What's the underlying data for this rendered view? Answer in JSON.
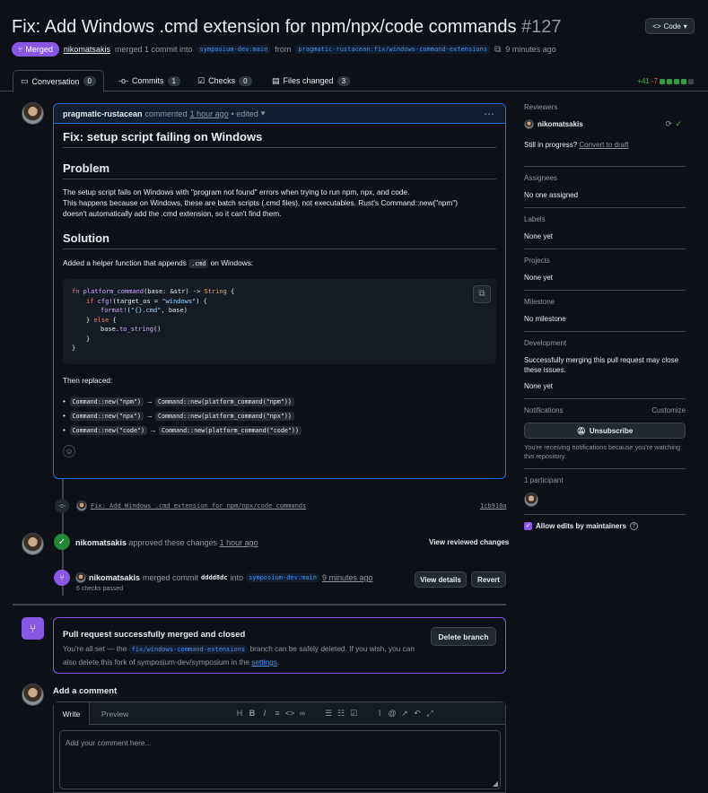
{
  "pr": {
    "title": "Fix: Add Windows .cmd extension for npm/npx/code commands",
    "number": "#127",
    "status": "Merged",
    "author": "nikomatsakis",
    "merged_text": "merged 1 commit into",
    "base_branch": "symposium-dev:main",
    "from": "from",
    "head_branch": "pragmatic-rustacean:fix/windows-command-extensions",
    "time": "9 minutes ago",
    "code_button": "Code"
  },
  "tabs": [
    {
      "label": "Conversation",
      "count": "0"
    },
    {
      "label": "Commits",
      "count": "1"
    },
    {
      "label": "Checks",
      "count": "0"
    },
    {
      "label": "Files changed",
      "count": "3"
    }
  ],
  "diffstat": {
    "added": "+41",
    "removed": "-7"
  },
  "comment": {
    "author": "pragmatic-rustacean",
    "action": "commented",
    "time": "1 hour ago",
    "edited": "• edited",
    "h1": "Fix: setup script failing on Windows",
    "problem_heading": "Problem",
    "problem_p1": "The setup script fails on Windows with \"program not found\" errors when trying to run npm, npx, and code.",
    "problem_p2": "This happens because on Windows, these are batch scripts (.cmd files), not executables. Rust's Command::new(\"npm\")",
    "problem_p3": "doesn't automatically add the .cmd extension, so it can't find them.",
    "solution_heading": "Solution",
    "solution_p_pre": "Added a helper function that appends",
    "solution_p_code": ".cmd",
    "solution_p_post": "on Windows:",
    "replaced": "Then replaced:",
    "replacements": [
      {
        "from": "Command::new(\"npm\")",
        "to": "Command::new(platform_command(\"npm\"))"
      },
      {
        "from": "Command::new(\"npx\")",
        "to": "Command::new(platform_command(\"npx\"))"
      },
      {
        "from": "Command::new(\"code\")",
        "to": "Command::new(platform_command(\"code\"))"
      }
    ],
    "arrow": "→"
  },
  "commit": {
    "message": "Fix: Add Windows .cmd extension for npm/npx/code commands",
    "sha": "1cb910a"
  },
  "approval": {
    "user": "nikomatsakis",
    "action": "approved these changes",
    "time": "1 hour ago",
    "button": "View reviewed changes"
  },
  "merge_event": {
    "user": "nikomatsakis",
    "action": "merged commit",
    "sha": "dddd8dc",
    "into": "into",
    "branch": "symposium-dev:main",
    "time": "9 minutes ago",
    "checks": "6 checks passed",
    "view_details": "View details",
    "revert": "Revert"
  },
  "merged_box": {
    "title": "Pull request successfully merged and closed",
    "text_pre": "You're all set — the",
    "branch": "fix/windows-command-extensions",
    "text_post": "branch can be safely deleted. If you wish, you can",
    "text2": "also delete this fork of symposium-dev/symposium in the",
    "settings_link": "settings",
    "period": ".",
    "delete_button": "Delete branch"
  },
  "add_comment": {
    "heading": "Add a comment",
    "write_tab": "Write",
    "preview_tab": "Preview",
    "placeholder": "Add your comment here..."
  },
  "sidebar": {
    "reviewers_h": "Reviewers",
    "reviewer": "nikomatsakis",
    "still_progress": "Still in progress?",
    "convert": "Convert to draft",
    "assignees_h": "Assignees",
    "assignees_v": "No one assigned",
    "labels_h": "Labels",
    "labels_v": "None yet",
    "projects_h": "Projects",
    "projects_v": "None yet",
    "milestone_h": "Milestone",
    "milestone_v": "No milestone",
    "development_h": "Development",
    "development_v": "Successfully merging this pull request may close these issues.",
    "development_v2": "None yet",
    "notifications_h": "Notifications",
    "customize": "Customize",
    "unsubscribe": "Unsubscribe",
    "notif_text": "You're receiving notifications because you're watching this repository.",
    "participants_h": "1 participant",
    "allow_edits": "Allow edits by maintainers"
  }
}
